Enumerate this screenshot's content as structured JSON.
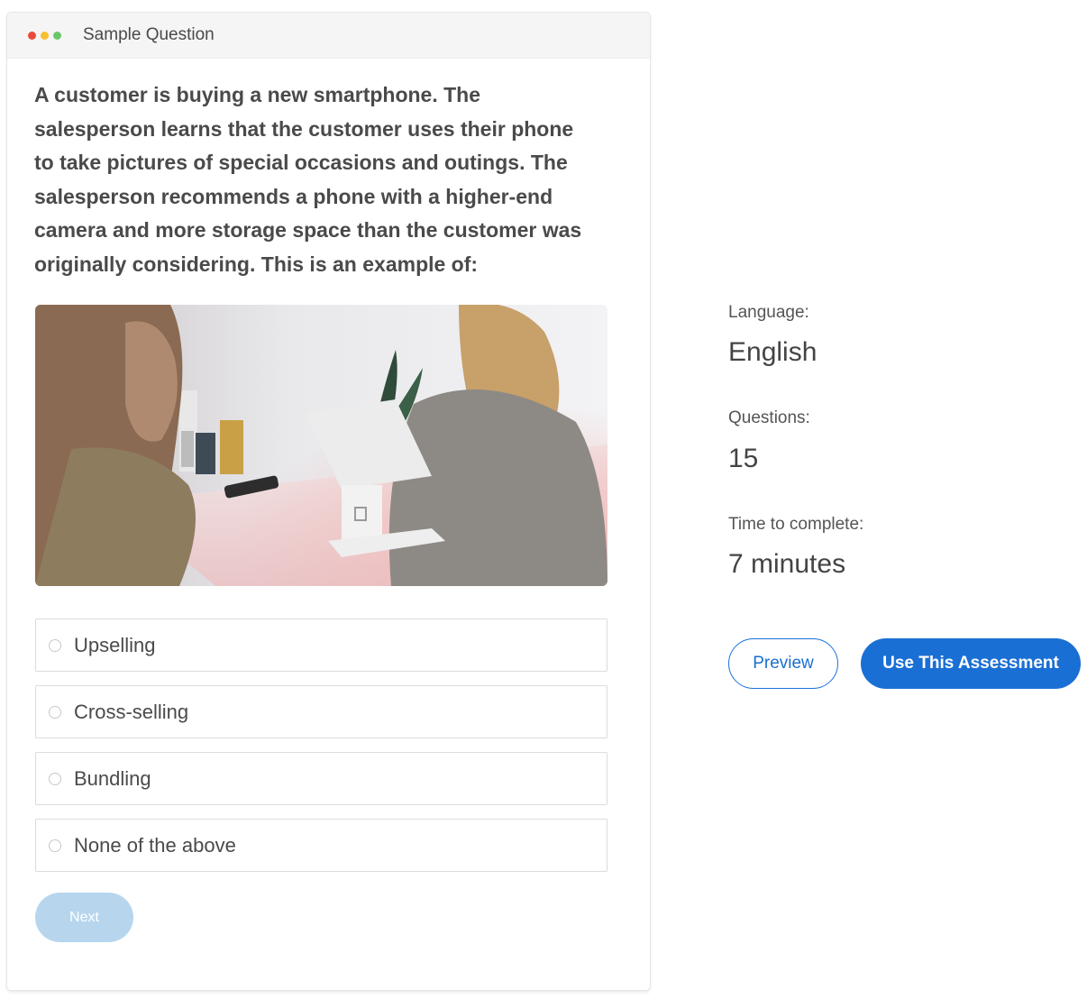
{
  "window": {
    "title": "Sample Question",
    "dot_colors": [
      "#e94b3c",
      "#f5c12e",
      "#6cc76a"
    ]
  },
  "question": {
    "text": "A customer is buying a new smartphone. The\nsalesperson learns that the customer  uses their phone\nto take pictures of special occasions and outings. The\nsalesperson recommends a phone with a higher-end\ncamera and more storage space than the customer was\noriginally considering. This is an example of:"
  },
  "options": [
    {
      "label": "Upselling"
    },
    {
      "label": "Cross-selling"
    },
    {
      "label": "Bundling"
    },
    {
      "label": "None of the above"
    }
  ],
  "next_label": "Next",
  "info": {
    "language_label": "Language:",
    "language_value": "English",
    "questions_label": "Questions:",
    "questions_value": "15",
    "time_label": "Time to complete:",
    "time_value": "7 minutes"
  },
  "buttons": {
    "preview_label": "Preview",
    "use_label": "Use This Assessment"
  },
  "colors": {
    "accent": "#1a6fd4",
    "next_disabled": "#b7d6ee"
  }
}
